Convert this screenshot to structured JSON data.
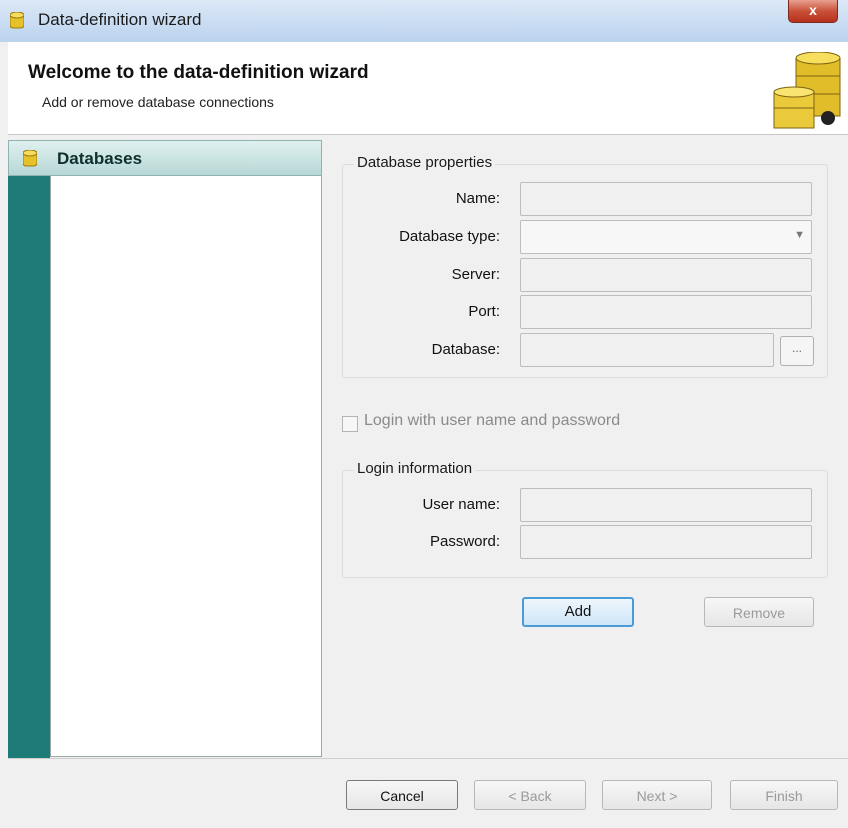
{
  "window": {
    "title": "Data-definition wizard",
    "close_label": "x"
  },
  "header": {
    "title": "Welcome to the data-definition wizard",
    "subtitle": "Add or remove database connections"
  },
  "sidebar": {
    "section_label": "Databases"
  },
  "db_props": {
    "group_label": "Database properties",
    "name_label": "Name:",
    "type_label": "Database type:",
    "server_label": "Server:",
    "port_label": "Port:",
    "database_label": "Database:",
    "browse_label": "..."
  },
  "login": {
    "checkbox_label": "Login with user name and password",
    "group_label": "Login information",
    "username_label": "User name:",
    "password_label": "Password:"
  },
  "actions": {
    "add": "Add",
    "remove": "Remove"
  },
  "footer": {
    "cancel": "Cancel",
    "back": "< Back",
    "next": "Next >",
    "finish": "Finish"
  }
}
